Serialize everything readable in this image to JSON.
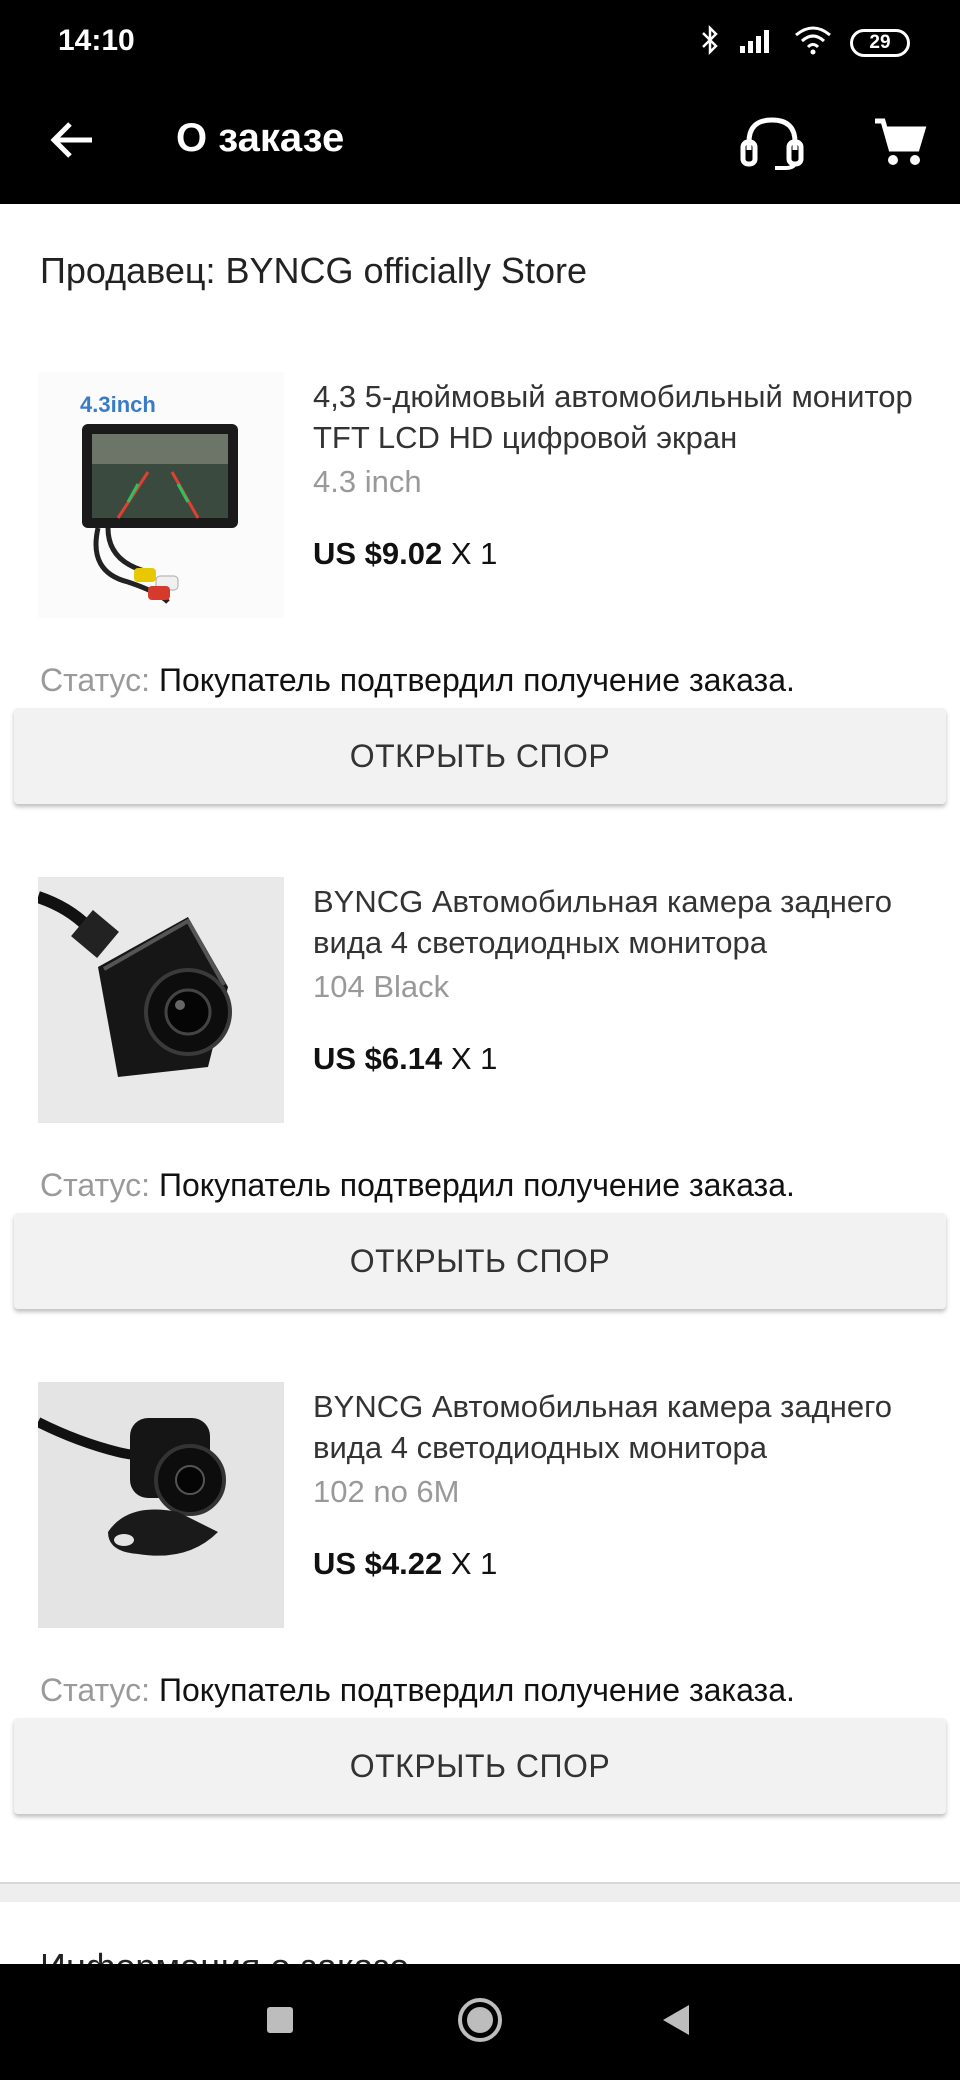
{
  "status_bar": {
    "time": "14:10",
    "battery": "29"
  },
  "app_bar": {
    "title": "О заказе"
  },
  "seller": {
    "label": "Продавец: BYNCG officially Store"
  },
  "items": [
    {
      "thumb_caption": "4.3inch",
      "title": "4,3 5-дюймовый автомобильный монитор TFT LCD HD цифровой экран",
      "variant": "4.3 inch",
      "price": "US $9.02",
      "qty": "X 1",
      "status_label": "Статус:",
      "status_text": "Покупатель подтвердил получение заказа.",
      "button_label": "ОТКРЫТЬ СПОР"
    },
    {
      "thumb_caption": "",
      "title": "BYNCG Автомобильная камера заднего вида 4 светодиодных монитора",
      "variant": "104 Black",
      "price": "US $6.14",
      "qty": "X 1",
      "status_label": "Статус:",
      "status_text": "Покупатель подтвердил получение заказа.",
      "button_label": "ОТКРЫТЬ СПОР"
    },
    {
      "thumb_caption": "",
      "title": "BYNCG Автомобильная камера заднего вида 4 светодиодных монитора",
      "variant": "102 no 6M",
      "price": "US $4.22",
      "qty": "X 1",
      "status_label": "Статус:",
      "status_text": "Покупатель подтвердил получение заказа.",
      "button_label": "ОТКРЫТЬ СПОР"
    }
  ],
  "order_info": {
    "title": "Информация о заказе"
  },
  "icons": {
    "back": "arrow-left-icon",
    "support": "headset-icon",
    "cart": "cart-icon",
    "nav_recents": "square-icon",
    "nav_home": "circle-icon",
    "nav_back": "triangle-icon"
  }
}
